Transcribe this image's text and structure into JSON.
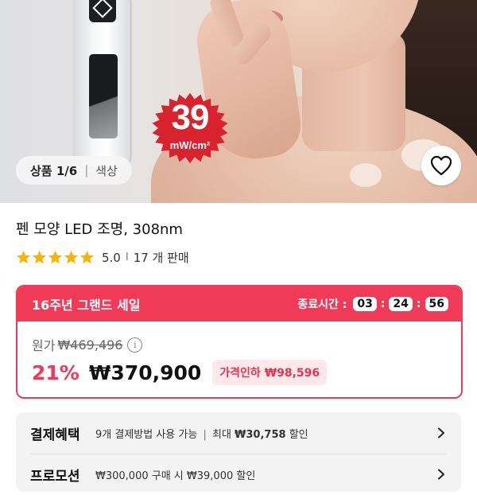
{
  "gallery": {
    "badge_value": "39",
    "badge_unit": "mW/cm²",
    "counter": "상품 1/6",
    "counter_separator": "|",
    "color_label": "색상",
    "wishlist_icon": "heart-icon"
  },
  "product": {
    "title": "펜 모양 LED 조명, 308nm",
    "rating": "5.0",
    "rating_separator": "I",
    "sold": "17 개 판매",
    "stars": 5
  },
  "sale": {
    "title": "16주년 그랜드 세일",
    "timer_label": "종료시간 :",
    "hours": "03",
    "minutes": "24",
    "seconds": "56",
    "timer_colon": ":",
    "original_label": "원가",
    "original_price": "₩469,496",
    "info_icon": "i",
    "discount": "21%",
    "price": "₩370,900",
    "price_cut": "가격인하 ₩98,596"
  },
  "benefits": {
    "payment_label": "결제혜택",
    "payment_desc_1": "9개 결제방법 사용 가능",
    "payment_sep": "|",
    "payment_desc_2": "최대",
    "payment_amount": "₩30,758",
    "payment_desc_3": "할인",
    "promo_label": "프로모션",
    "promo_desc": "₩300,000 구매 시 ₩39,000 할인"
  },
  "colors": {
    "accent": "#ef3a58",
    "star": "#f7b500",
    "badge": "#d8222e"
  }
}
